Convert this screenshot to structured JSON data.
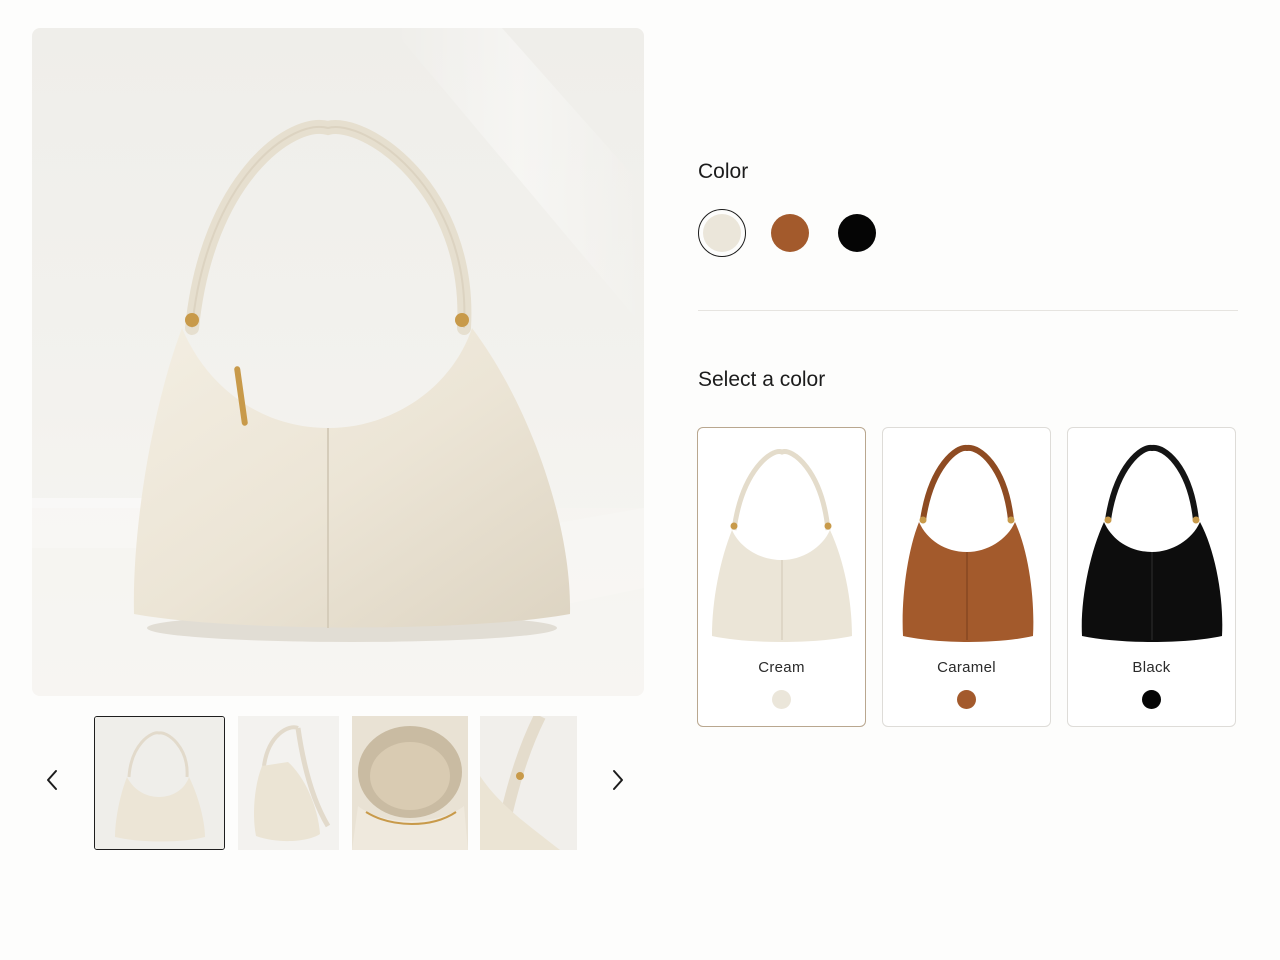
{
  "product": {
    "variants": [
      {
        "name": "Cream",
        "swatch_color": "#ebe6da",
        "selected": true
      },
      {
        "name": "Caramel",
        "swatch_color": "#a35a2c",
        "selected": false
      },
      {
        "name": "Black",
        "swatch_color": "#050505",
        "selected": false
      }
    ]
  },
  "gallery": {
    "selected_index": 0,
    "thumbnails": [
      {
        "view": "front-studio",
        "selected": true
      },
      {
        "view": "side-angle",
        "selected": false
      },
      {
        "view": "interior-open",
        "selected": false
      },
      {
        "view": "strap-detail",
        "selected": false
      }
    ],
    "prev_icon": "chevron-left-icon",
    "next_icon": "chevron-right-icon"
  },
  "options": {
    "color_label": "Color",
    "select_label": "Select a color"
  },
  "colors": {
    "cream": "#ebe6da",
    "caramel": "#a35a2c",
    "black": "#050505",
    "selected_card_border": "#b9a78f"
  }
}
